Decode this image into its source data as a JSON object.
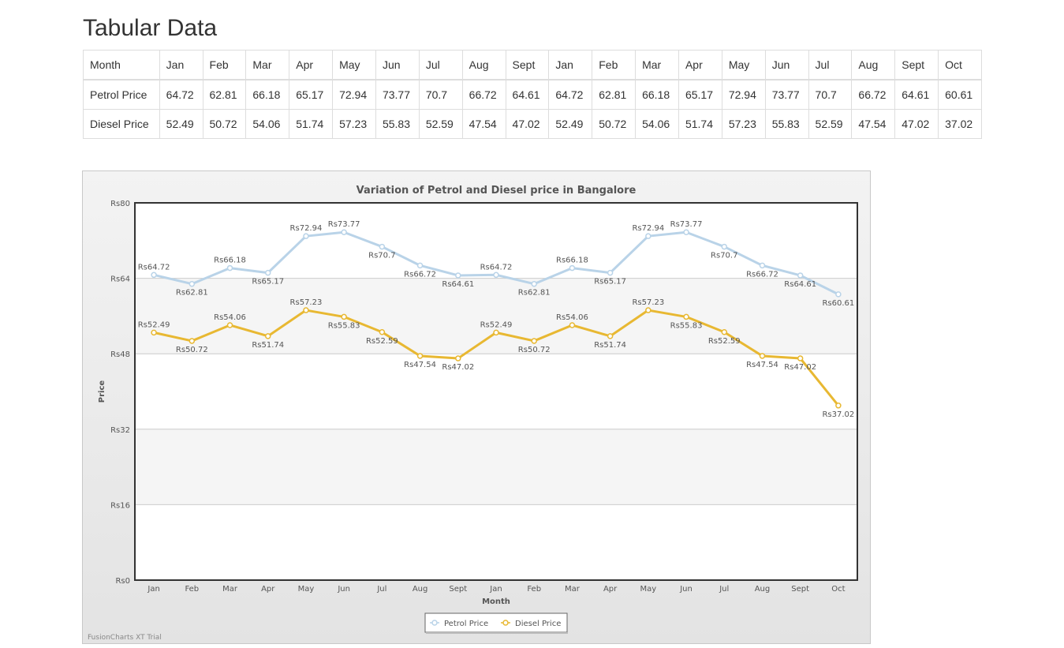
{
  "page": {
    "title": "Tabular Data"
  },
  "table": {
    "header_label": "Month",
    "months": [
      "Jan",
      "Feb",
      "Mar",
      "Apr",
      "May",
      "Jun",
      "Jul",
      "Aug",
      "Sept",
      "Jan",
      "Feb",
      "Mar",
      "Apr",
      "May",
      "Jun",
      "Jul",
      "Aug",
      "Sept",
      "Oct"
    ],
    "rows": [
      {
        "label": "Petrol Price",
        "values": [
          "64.72",
          "62.81",
          "66.18",
          "65.17",
          "72.94",
          "73.77",
          "70.7",
          "66.72",
          "64.61",
          "64.72",
          "62.81",
          "66.18",
          "65.17",
          "72.94",
          "73.77",
          "70.7",
          "66.72",
          "64.61",
          "60.61"
        ]
      },
      {
        "label": "Diesel Price",
        "values": [
          "52.49",
          "50.72",
          "54.06",
          "51.74",
          "57.23",
          "55.83",
          "52.59",
          "47.54",
          "47.02",
          "52.49",
          "50.72",
          "54.06",
          "51.74",
          "57.23",
          "55.83",
          "52.59",
          "47.54",
          "47.02",
          "37.02"
        ]
      }
    ]
  },
  "chart_data": {
    "type": "line",
    "title": "Variation of Petrol and Diesel price in Bangalore",
    "xlabel": "Month",
    "ylabel": "Price",
    "categories": [
      "Jan",
      "Feb",
      "Mar",
      "Apr",
      "May",
      "Jun",
      "Jul",
      "Aug",
      "Sept",
      "Jan",
      "Feb",
      "Mar",
      "Apr",
      "May",
      "Jun",
      "Jul",
      "Aug",
      "Sept",
      "Oct"
    ],
    "ylim": [
      0,
      80
    ],
    "yticks": [
      0,
      16,
      32,
      48,
      64,
      80
    ],
    "value_prefix": "Rs",
    "grid": true,
    "legend": "bottom",
    "credit": "FusionCharts XT Trial",
    "series": [
      {
        "name": "Petrol Price",
        "color": "#b9d3e8",
        "values": [
          64.72,
          62.81,
          66.18,
          65.17,
          72.94,
          73.77,
          70.7,
          66.72,
          64.61,
          64.72,
          62.81,
          66.18,
          65.17,
          72.94,
          73.77,
          70.7,
          66.72,
          64.61,
          60.61
        ]
      },
      {
        "name": "Diesel Price",
        "color": "#e8b832",
        "values": [
          52.49,
          50.72,
          54.06,
          51.74,
          57.23,
          55.83,
          52.59,
          47.54,
          47.02,
          52.49,
          50.72,
          54.06,
          51.74,
          57.23,
          55.83,
          52.59,
          47.54,
          47.02,
          37.02
        ]
      }
    ]
  }
}
